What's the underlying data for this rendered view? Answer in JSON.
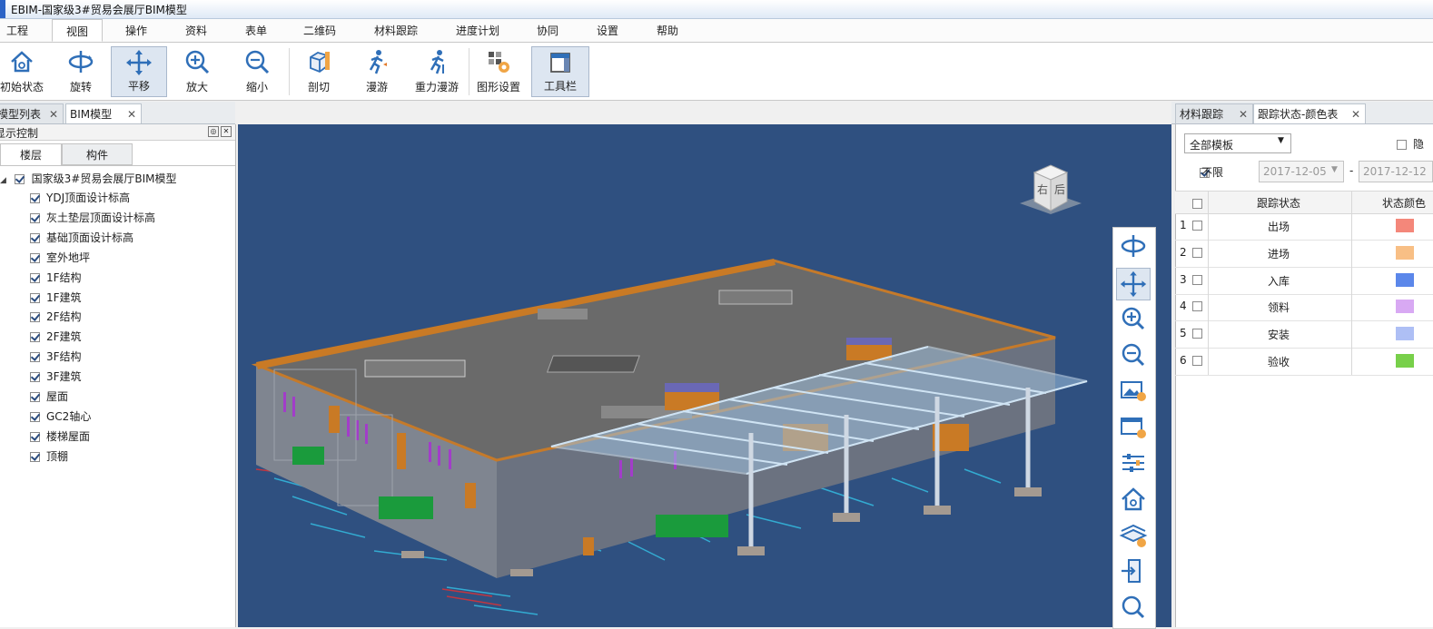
{
  "window": {
    "title": "EBIM-国家级3#贸易会展厅BIM模型"
  },
  "menu": {
    "items": [
      {
        "label": "工程"
      },
      {
        "label": "视图",
        "active": true
      },
      {
        "label": "操作"
      },
      {
        "label": "资料"
      },
      {
        "label": "表单"
      },
      {
        "label": "二维码"
      },
      {
        "label": "材料跟踪"
      },
      {
        "label": "进度计划"
      },
      {
        "label": "协同"
      },
      {
        "label": "设置"
      },
      {
        "label": "帮助"
      }
    ]
  },
  "ribbon": {
    "tools": [
      {
        "label": "初始状态",
        "icon": "home-icon"
      },
      {
        "label": "旋转",
        "icon": "rotate-icon"
      },
      {
        "label": "平移",
        "icon": "pan-icon",
        "pressed": true
      },
      {
        "label": "放大",
        "icon": "zoom-in-icon"
      },
      {
        "label": "缩小",
        "icon": "zoom-out-icon"
      },
      {
        "label": "剖切",
        "icon": "section-box-icon"
      },
      {
        "label": "漫游",
        "icon": "walk-icon"
      },
      {
        "label": "重力漫游",
        "icon": "gravity-walk-icon"
      },
      {
        "label": "图形设置",
        "icon": "graphics-settings-icon"
      },
      {
        "label": "工具栏",
        "icon": "toolbar-icon",
        "pressed": true
      }
    ]
  },
  "left_tabs": [
    {
      "label": "模型列表"
    },
    {
      "label": "BIM模型",
      "active": true
    }
  ],
  "left_panel": {
    "title": "显示控制",
    "subtabs": [
      {
        "label": "楼层",
        "active": true
      },
      {
        "label": "构件"
      }
    ],
    "tree": {
      "root": "国家级3#贸易会展厅BIM模型",
      "items": [
        "YDJ顶面设计标高",
        "灰土垫层顶面设计标高",
        "基础顶面设计标高",
        "室外地坪",
        "1F结构",
        "1F建筑",
        "2F结构",
        "2F建筑",
        "3F结构",
        "3F建筑",
        "屋面",
        "GC2轴心",
        "楼梯屋面",
        "顶棚"
      ]
    }
  },
  "viewcube": {
    "face_right": "右",
    "face_back": "后"
  },
  "right_tabs": [
    {
      "label": "材料跟踪"
    },
    {
      "label": "跟踪状态-颜色表",
      "active": true
    }
  ],
  "right_panel": {
    "template_select": "全部模板",
    "hide_label": "隐",
    "unlimited_label": "不限",
    "date_from": "2017-12-05",
    "date_sep": "-",
    "date_to": "2017-12-12",
    "columns": {
      "status": "跟踪状态",
      "color": "状态颜色"
    },
    "rows": [
      {
        "num": "1",
        "status": "出场",
        "color": "#f4877a"
      },
      {
        "num": "2",
        "status": "进场",
        "color": "#f8bf85"
      },
      {
        "num": "3",
        "status": "入库",
        "color": "#5b87ea"
      },
      {
        "num": "4",
        "status": "领料",
        "color": "#d8a9f3"
      },
      {
        "num": "5",
        "status": "安装",
        "color": "#aebff5"
      },
      {
        "num": "6",
        "status": "验收",
        "color": "#78d04a"
      }
    ]
  },
  "colors": {
    "viewport_bg": "#2f5080",
    "accent": "#2b63c6"
  }
}
